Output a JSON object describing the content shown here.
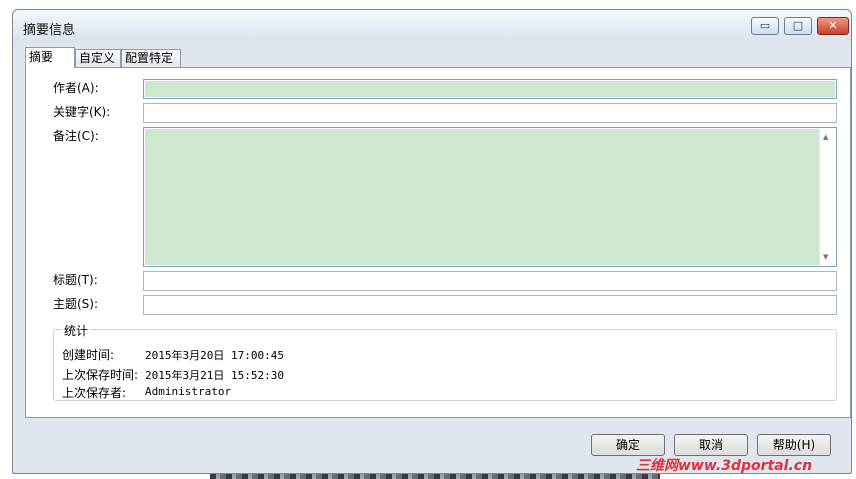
{
  "window": {
    "title": "摘要信息",
    "minimize": "▭",
    "maximize": "□",
    "close": "✕"
  },
  "tabs": [
    {
      "label": "摘要"
    },
    {
      "label": "自定义"
    },
    {
      "label": "配置特定"
    }
  ],
  "fields": {
    "author": {
      "label": "作者(A):",
      "value": ""
    },
    "keywords": {
      "label": "关键字(K):",
      "value": ""
    },
    "comments": {
      "label": "备注(C):",
      "value": ""
    },
    "title": {
      "label": "标题(T):",
      "value": ""
    },
    "subject": {
      "label": "主题(S):",
      "value": ""
    }
  },
  "stats": {
    "title": "统计",
    "created_label": "创建时间:",
    "created_value": "2015年3月20日 17:00:45",
    "saved_label": "上次保存时间:",
    "saved_value": "2015年3月21日 15:52:30",
    "savedby_label": "上次保存者:",
    "savedby_value": "Administrator"
  },
  "buttons": {
    "ok": "确定",
    "cancel": "取消",
    "help": "帮助(H)"
  },
  "watermark": "三维网www.3dportal.cn",
  "colors": {
    "field_highlight": "#cde7d0",
    "watermark": "#e0303c"
  }
}
